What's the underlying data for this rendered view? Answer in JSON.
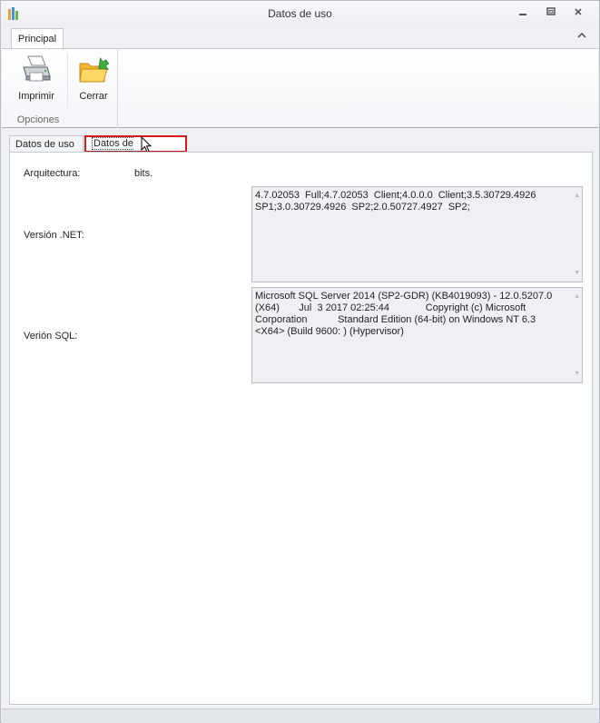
{
  "window": {
    "title": "Datos de uso",
    "controls": [
      "minimize-icon",
      "restore-icon",
      "close-icon"
    ]
  },
  "ribbon": {
    "tab": "Principal",
    "buttons": [
      {
        "label": "Imprimir",
        "icon": "printer-icon"
      },
      {
        "label": "Cerrar",
        "icon": "folder-exit-icon"
      }
    ],
    "group_label": "Opciones"
  },
  "tabs": {
    "usage": "Datos de uso",
    "install": "Datos de instalación"
  },
  "install": {
    "arch_label": "Arquitectura:",
    "arch_value": "bits.",
    "net_label": "Versión .NET:",
    "net_value": "4.7.02053  Full;4.7.02053  Client;4.0.0.0  Client;3.5.30729.4926\nSP1;3.0.30729.4926  SP2;2.0.50727.4927  SP2;",
    "sql_label": "Verión SQL:",
    "sql_value": "Microsoft SQL Server 2014 (SP2-GDR) (KB4019093) - 12.0.5207.0\n(X64)       Jul  3 2017 02:25:44             Copyright (c) Microsoft\nCorporation           Standard Edition (64-bit) on Windows NT 6.3\n<X64> (Build 9600: ) (Hypervisor)"
  },
  "colors": {
    "highlight_border": "#d11a1a",
    "textbox_bg": "#eef0f4"
  }
}
